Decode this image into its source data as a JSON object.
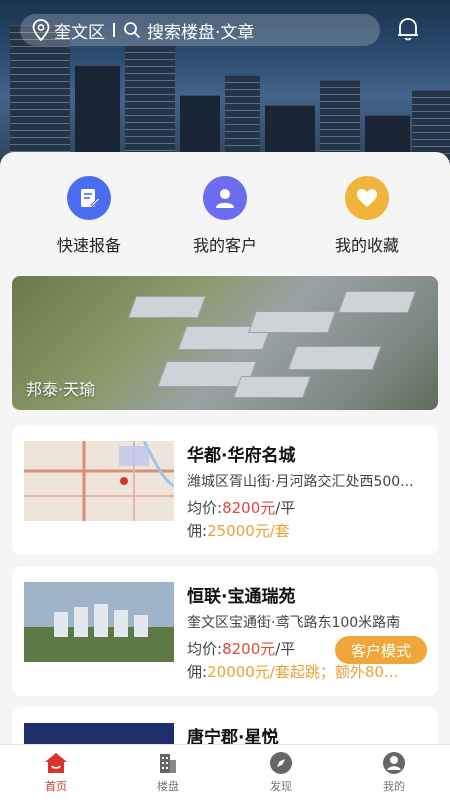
{
  "header": {
    "location": "奎文区",
    "search_placeholder": "搜索楼盘·文章"
  },
  "quick_actions": [
    {
      "label": "快速报备",
      "icon": "edit-icon",
      "color": "#4a6cf0"
    },
    {
      "label": "我的客户",
      "icon": "user-icon",
      "color": "#6b6cf0"
    },
    {
      "label": "我的收藏",
      "icon": "heart-icon",
      "color": "#f0b33b"
    }
  ],
  "banner": {
    "caption": "邦泰·天瑜"
  },
  "listings": [
    {
      "name": "华都·华府名城",
      "address": "潍城区胥山街·月河路交汇处西500...",
      "price_label": "均价:",
      "price": "8200元",
      "price_unit": "/平",
      "comm_label": "佣:",
      "commission": "25000元/套"
    },
    {
      "name": "恒联·宝通瑞苑",
      "address": "奎文区宝通街·鸢飞路东100米路南",
      "price_label": "均价:",
      "price": "8200元",
      "price_unit": "/平",
      "comm_label": "佣:",
      "commission": "20000元/套起跳；额外80..."
    },
    {
      "name": "唐宁郡·星悦",
      "address": "",
      "price_label": "",
      "price": "",
      "price_unit": "",
      "comm_label": "",
      "commission": ""
    }
  ],
  "mode_button": "客户模式",
  "tabs": [
    {
      "label": "首页",
      "icon": "home-icon",
      "active": true
    },
    {
      "label": "楼盘",
      "icon": "building-icon",
      "active": false
    },
    {
      "label": "发现",
      "icon": "compass-icon",
      "active": false
    },
    {
      "label": "我的",
      "icon": "profile-icon",
      "active": false
    }
  ],
  "colors": {
    "accent": "#d9342b",
    "price": "#e2473a",
    "commission": "#e9a23b"
  }
}
